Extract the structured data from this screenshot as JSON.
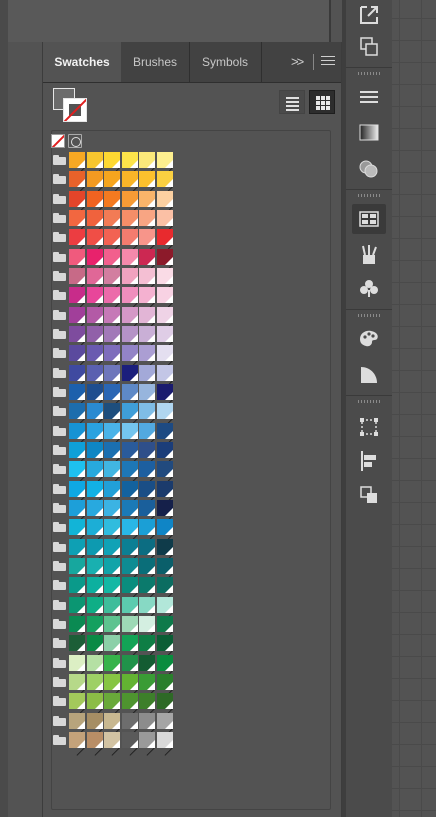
{
  "panel": {
    "tabs": [
      {
        "label": "Swatches",
        "active": true
      },
      {
        "label": "Brushes",
        "active": false
      },
      {
        "label": "Symbols",
        "active": false
      }
    ],
    "expand_glyph": ">>"
  },
  "toolbar_icons": [
    "export-icon",
    "arrange-icon",
    "align-panel-icon",
    "gradient-icon",
    "transparency-icon",
    "swatches-icon",
    "brushes-icon",
    "symbols-icon",
    "color-guide-icon",
    "appearance-icon",
    "transform-icon",
    "align-icon",
    "pathfinder-icon"
  ],
  "swatch_rows": [
    [
      "#f7a823",
      "#f7c62f",
      "#fdd832",
      "#fde44a",
      "#fbe97a",
      "#fef08f"
    ],
    [
      "#e8622a",
      "#f39a21",
      "#f6a51e",
      "#f9b528",
      "#fcc12d",
      "#fbd041"
    ],
    [
      "#e4452a",
      "#f06321",
      "#f47a20",
      "#f79b35",
      "#f9b46a",
      "#fcd0a1"
    ],
    [
      "#f26740",
      "#f0623d",
      "#f27b55",
      "#f58e68",
      "#f8a583",
      "#fbc0a5"
    ],
    [
      "#ec3d41",
      "#f04e46",
      "#f26253",
      "#f47c6f",
      "#f7958a",
      "#e82a2e"
    ],
    [
      "#f05a7d",
      "#e8226c",
      "#f25f8d",
      "#f589ab",
      "#cc2852",
      "#8c1a2a"
    ],
    [
      "#c76a87",
      "#e06797",
      "#d27ea0",
      "#f0a2bf",
      "#f4bfd3",
      "#fadbe6"
    ],
    [
      "#c82c8a",
      "#e8469a",
      "#ec6aaa",
      "#f08ebd",
      "#f4b1d0",
      "#f8d2e3"
    ],
    [
      "#a13f9a",
      "#b35aa6",
      "#c679b7",
      "#d598c7",
      "#e2b5d6",
      "#efd3e6"
    ],
    [
      "#7e4c9e",
      "#9160a9",
      "#a279b8",
      "#b593c7",
      "#c9afd6",
      "#dfcde6"
    ],
    [
      "#5b4a9e",
      "#6a5ab0",
      "#7e6dbc",
      "#9384c7",
      "#ab9ed3",
      "#e4dff0"
    ],
    [
      "#3f4aa0",
      "#5a60b0",
      "#6e76bb",
      "#1b1f7c",
      "#a3a9d8",
      "#c3c6e6"
    ],
    [
      "#1c60ac",
      "#1f4e8f",
      "#2a66b4",
      "#5e89c7",
      "#97b5dd",
      "#1a1b6e"
    ],
    [
      "#1d6dad",
      "#2a8ad1",
      "#1e4e7d",
      "#3f9ed8",
      "#7fbde6",
      "#b0d6f0"
    ],
    [
      "#1793d4",
      "#2aa2e0",
      "#4ab3e8",
      "#74c5ee",
      "#52a9e0",
      "#1d4a82"
    ],
    [
      "#0fa0d8",
      "#0e86c4",
      "#1b6fb0",
      "#2a5b9b",
      "#2f4f8a",
      "#1b3d79"
    ],
    [
      "#1ec0ef",
      "#27a9dd",
      "#41b6e2",
      "#1e77b6",
      "#1d5fa0",
      "#214a7e"
    ],
    [
      "#0fa8e3",
      "#12b1e5",
      "#21a0d8",
      "#13629e",
      "#1a4e86",
      "#1b3b6c"
    ],
    [
      "#1d9fd9",
      "#28a9df",
      "#3bb3e3",
      "#1b7ab7",
      "#1a5f9b",
      "#15204a"
    ],
    [
      "#12b4d7",
      "#1caed6",
      "#30bcde",
      "#29b7e7",
      "#1b9fd6",
      "#0f85c6"
    ],
    [
      "#0ea0b4",
      "#0d9ab0",
      "#10a2b6",
      "#0b7f94",
      "#0c6d82",
      "#0f3b4a"
    ],
    [
      "#17a79e",
      "#19b0b0",
      "#11a4a9",
      "#0e8c93",
      "#0a6e79",
      "#0a5f6a"
    ],
    [
      "#0a9a8a",
      "#0db09f",
      "#13b8a4",
      "#0a8d7e",
      "#0b7a6c",
      "#0b6d61"
    ],
    [
      "#0b9672",
      "#0fae86",
      "#3ebd9b",
      "#5ccbaf",
      "#87d9c4",
      "#b2e7d9"
    ],
    [
      "#0a8a52",
      "#15a05f",
      "#5ec38f",
      "#9ed9b6",
      "#d4efe1",
      "#0e7a4a"
    ],
    [
      "#1c5e37",
      "#0a8a45",
      "#8bd0a8",
      "#13a356",
      "#0e7e45",
      "#0b5e35"
    ],
    [
      "#dcefc4",
      "#b5e0a4",
      "#36b34a",
      "#21934a",
      "#145c32",
      "#0a8c3e"
    ],
    [
      "#b6d989",
      "#9ed065",
      "#86c543",
      "#63b332",
      "#3a9c35",
      "#2a7f2c"
    ],
    [
      "#a3c95b",
      "#8cbd46",
      "#69a93a",
      "#4e942f",
      "#3d7f2a",
      "#2e6926"
    ],
    [
      "#b7a47c",
      "#a68e64",
      "#c8b890",
      "#6d6d6d",
      "#8c8c8c",
      "#a5a5a5"
    ],
    [
      "#c4a27a",
      "#b98e66",
      "#d2c3a3",
      "#5a5a5a",
      "#9a9a9a",
      "#d9d9d9"
    ]
  ]
}
